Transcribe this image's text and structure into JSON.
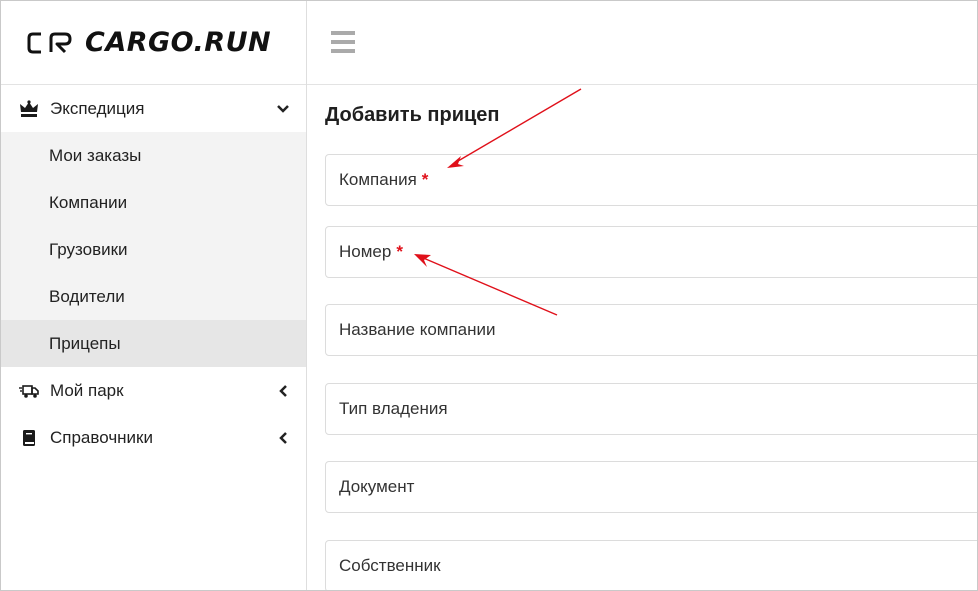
{
  "app": {
    "logo_text": "CARGO.RUN"
  },
  "sidebar": {
    "groups": [
      {
        "label": "Экспедиция",
        "icon": "crown-icon",
        "expanded": true
      },
      {
        "label": "Мой парк",
        "icon": "truck-icon",
        "expanded": false
      },
      {
        "label": "Справочники",
        "icon": "book-icon",
        "expanded": false
      }
    ],
    "sub_items": [
      "Мои заказы",
      "Компании",
      "Грузовики",
      "Водители",
      "Прицепы"
    ],
    "active_item": "Прицепы"
  },
  "page": {
    "title": "Добавить прицеп",
    "fields": [
      {
        "label": "Компания",
        "required": true
      },
      {
        "label": "Номер",
        "required": true
      },
      {
        "label": "Название компании",
        "required": false
      },
      {
        "label": "Тип владения",
        "required": false
      },
      {
        "label": "Документ",
        "required": false
      },
      {
        "label": "Собственник",
        "required": false
      }
    ],
    "required_marker": "*"
  },
  "colors": {
    "annotation_arrow": "#e0101a",
    "required": "#e0101a"
  }
}
